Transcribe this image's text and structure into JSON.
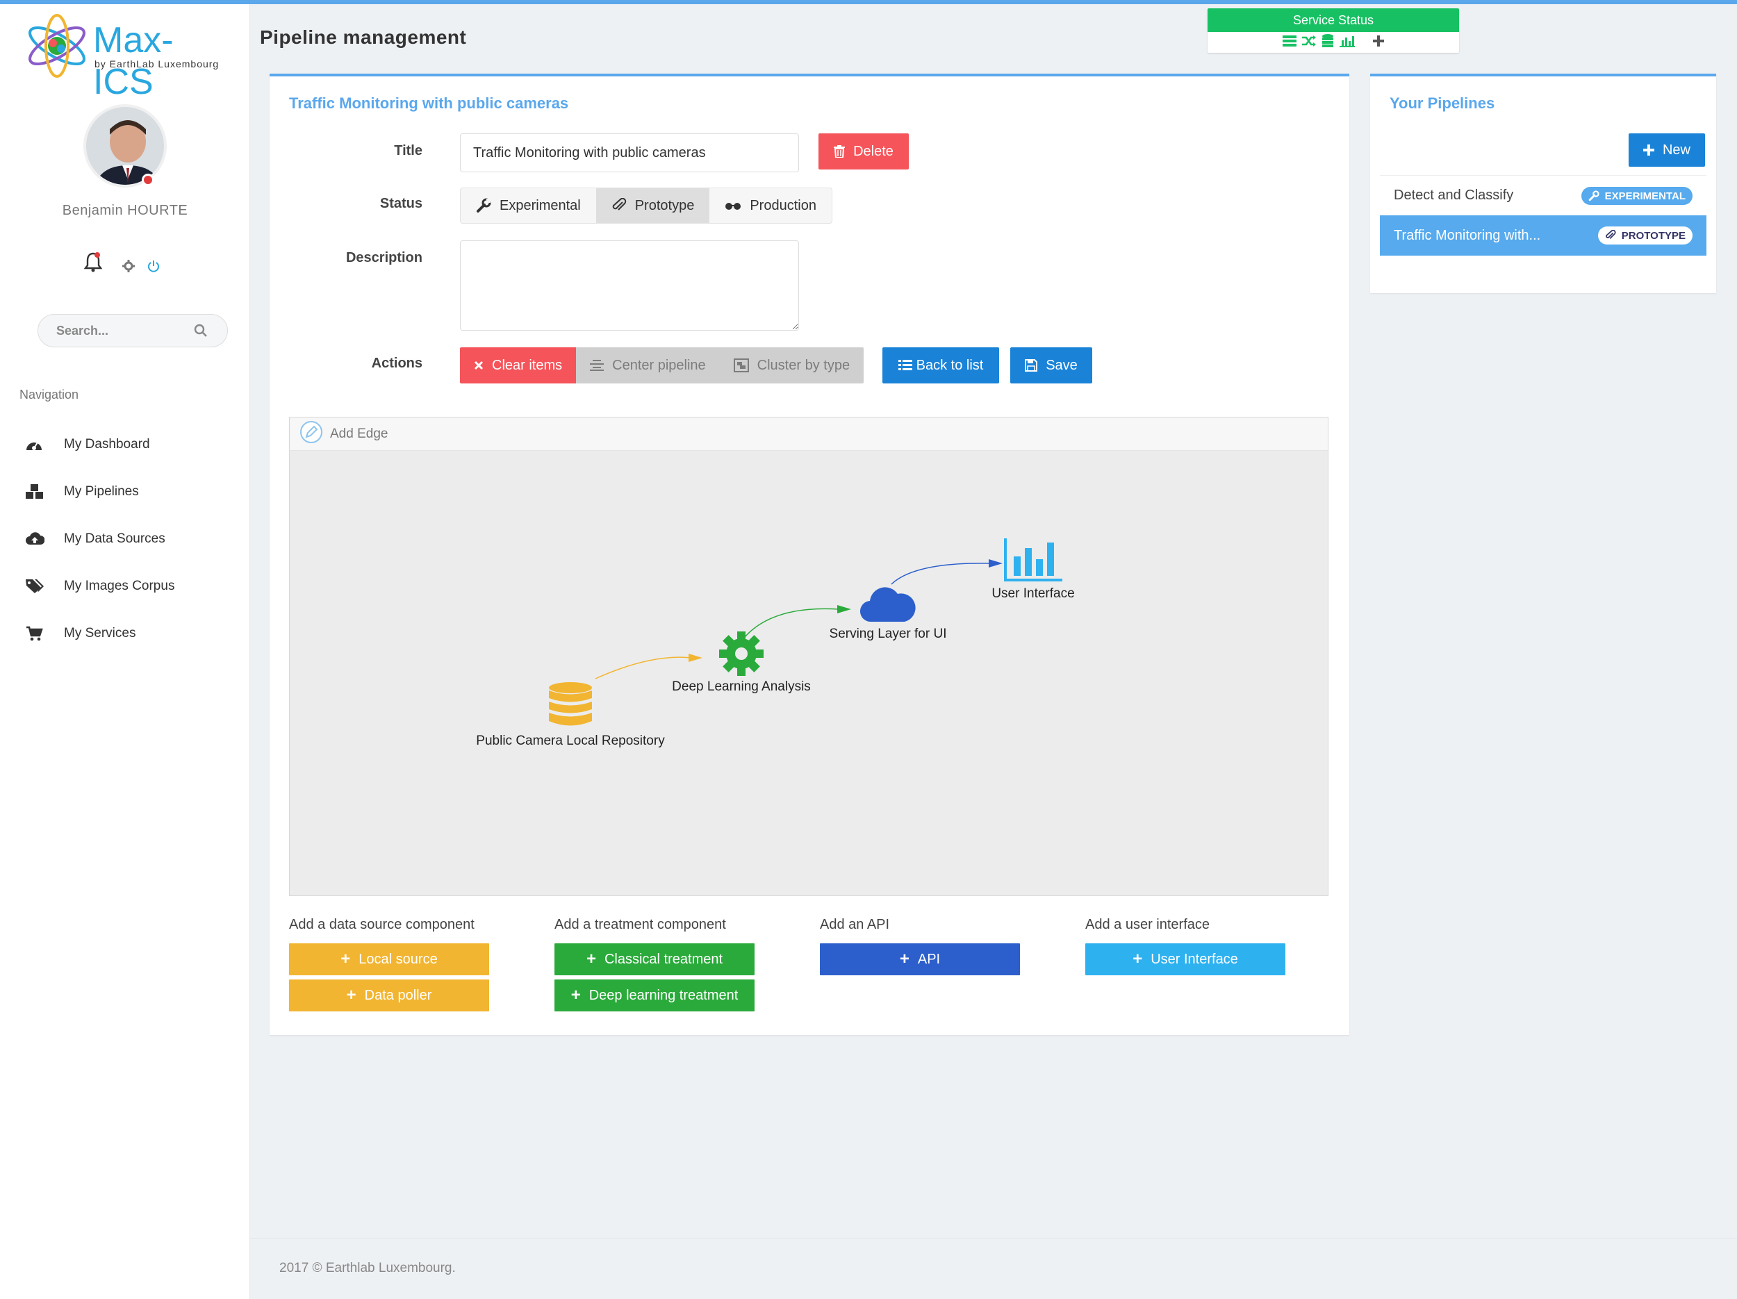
{
  "app": {
    "logo_text": "Max-ICS",
    "logo_sub": "by EarthLab Luxembourg"
  },
  "user": {
    "name": "Benjamin HOURTE"
  },
  "search": {
    "placeholder": "Search..."
  },
  "nav": {
    "title": "Navigation",
    "items": [
      {
        "label": "My Dashboard",
        "icon": "dashboard-icon"
      },
      {
        "label": "My Pipelines",
        "icon": "cubes-icon"
      },
      {
        "label": "My Data Sources",
        "icon": "cloud-upload-icon"
      },
      {
        "label": "My Images Corpus",
        "icon": "tags-icon"
      },
      {
        "label": "My Services",
        "icon": "cart-icon"
      }
    ]
  },
  "header": {
    "title": "Pipeline management"
  },
  "service_status": {
    "label": "Service Status",
    "color": "#17c163"
  },
  "editor": {
    "card_title": "Traffic Monitoring with public cameras",
    "title_label": "Title",
    "title_value": "Traffic Monitoring with public cameras",
    "delete_label": "Delete",
    "status_label": "Status",
    "status_options": [
      "Experimental",
      "Prototype",
      "Production"
    ],
    "status_selected": "Prototype",
    "description_label": "Description",
    "description_value": "",
    "actions_label": "Actions",
    "clear_label": "Clear items",
    "center_label": "Center pipeline",
    "cluster_label": "Cluster by type",
    "back_label": "Back to list",
    "save_label": "Save"
  },
  "canvas": {
    "add_edge_label": "Add Edge",
    "nodes": [
      {
        "label": "Public Camera Local Repository",
        "icon": "database-icon",
        "color": "#f2b531"
      },
      {
        "label": "Deep Learning Analysis",
        "icon": "gear-icon",
        "color": "#2aaa3a"
      },
      {
        "label": "Serving Layer for UI",
        "icon": "cloud-icon",
        "color": "#2c5fcc"
      },
      {
        "label": "User Interface",
        "icon": "bar-chart-icon",
        "color": "#2eb1ef"
      }
    ]
  },
  "components": {
    "data_source": {
      "title": "Add a data source component",
      "buttons": [
        "Local source",
        "Data poller"
      ]
    },
    "treatment": {
      "title": "Add a treatment component",
      "buttons": [
        "Classical treatment",
        "Deep learning treatment"
      ]
    },
    "api": {
      "title": "Add an API",
      "buttons": [
        "API"
      ]
    },
    "ui": {
      "title": "Add a user interface",
      "buttons": [
        "User Interface"
      ]
    }
  },
  "pipelines": {
    "title": "Your Pipelines",
    "new_label": "New",
    "items": [
      {
        "title": "Detect and Classify",
        "badge": "Experimental",
        "active": false
      },
      {
        "title": "Traffic Monitoring with...",
        "badge": "Prototype",
        "active": true
      }
    ]
  },
  "footer": {
    "text": "2017 © Earthlab Luxembourg."
  },
  "colors": {
    "accent": "#5aa7ec",
    "danger": "#f4545a",
    "primary": "#1a83d8"
  }
}
